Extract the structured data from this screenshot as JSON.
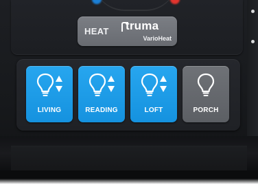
{
  "heat_control": {
    "label": "HEAT",
    "brand": "truma",
    "brand_sub": "VarioHeat"
  },
  "lights": [
    {
      "label": "LIVING",
      "state": "on",
      "dimmable": true,
      "icon": "lightbulb-icon"
    },
    {
      "label": "READING",
      "state": "on",
      "dimmable": true,
      "icon": "lightbulb-icon"
    },
    {
      "label": "LOFT",
      "state": "on",
      "dimmable": true,
      "icon": "lightbulb-icon"
    },
    {
      "label": "PORCH",
      "state": "off",
      "dimmable": false,
      "icon": "lightbulb-icon"
    }
  ],
  "colors": {
    "light_on": "#1e9eea",
    "light_off": "#63666b",
    "heat_button": "#72757b",
    "panel": "#222428"
  }
}
